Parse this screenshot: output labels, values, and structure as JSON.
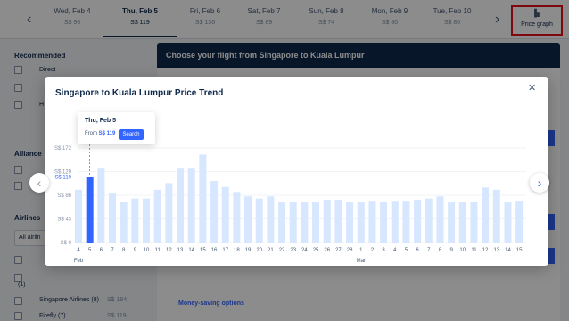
{
  "date_bar": {
    "prev_icon": "chevron-left-icon",
    "next_icon": "chevron-right-icon",
    "dates": [
      {
        "label": "Wed, Feb 4",
        "price": "S$ 96"
      },
      {
        "label": "Thu, Feb 5",
        "price": "S$ 119"
      },
      {
        "label": "Fri, Feb 6",
        "price": "S$ 136"
      },
      {
        "label": "Sat, Feb 7",
        "price": "S$ 89"
      },
      {
        "label": "Sun, Feb 8",
        "price": "S$ 74"
      },
      {
        "label": "Mon, Feb 9",
        "price": "S$ 80"
      },
      {
        "label": "Tue, Feb 10",
        "price": "S$ 80"
      }
    ],
    "active_index": 1,
    "price_graph_label": "Price graph",
    "price_graph_icon": "bar-chart-icon"
  },
  "sidebar": {
    "recommended_heading": "Recommended",
    "recommended_items": [
      "Direct",
      "",
      "H"
    ],
    "alliance_heading": "Alliance",
    "airlines_heading": "Airlines",
    "airlines_select": "All airlin",
    "airline_rows": [
      {
        "name": "",
        "price": ""
      },
      {
        "name": "(1)",
        "price": ""
      },
      {
        "name": "Singapore Airlines (8)",
        "price": "S$ 184"
      },
      {
        "name": "Firefly (7)",
        "price": "S$ 119"
      }
    ]
  },
  "main": {
    "header": "Choose your flight from Singapore to Kuala Lumpur",
    "money_saving": "Money-saving options"
  },
  "modal": {
    "title": "Singapore to Kuala Lumpur Price Trend",
    "close_icon": "close-icon",
    "tooltip": {
      "date": "Thu, Feb 5",
      "from_label": "From",
      "price": "S$ 119",
      "search_label": "Search"
    },
    "prev_icon": "chevron-left-icon",
    "next_icon": "chevron-right-icon"
  },
  "chart_data": {
    "type": "bar",
    "title": "Singapore to Kuala Lumpur Price Trend",
    "categories": [
      "4",
      "5",
      "6",
      "7",
      "8",
      "9",
      "10",
      "11",
      "12",
      "13",
      "14",
      "15",
      "16",
      "17",
      "18",
      "19",
      "20",
      "21",
      "22",
      "23",
      "24",
      "25",
      "26",
      "27",
      "28",
      "1",
      "2",
      "3",
      "4",
      "5",
      "6",
      "7",
      "8",
      "9",
      "10",
      "11",
      "12",
      "13",
      "14",
      "15"
    ],
    "month_labels": [
      {
        "index": 0,
        "label": "Feb"
      },
      {
        "index": 25,
        "label": "Mar"
      }
    ],
    "values": [
      96,
      119,
      136,
      89,
      74,
      80,
      80,
      96,
      108,
      136,
      136,
      160,
      112,
      101,
      92,
      84,
      80,
      84,
      74,
      74,
      74,
      74,
      78,
      78,
      74,
      74,
      76,
      74,
      76,
      76,
      78,
      80,
      84,
      74,
      74,
      74,
      100,
      96,
      74,
      76
    ],
    "selected_index": 1,
    "yticks": [
      {
        "value": 0,
        "label": "S$ 0"
      },
      {
        "value": 43,
        "label": "S$ 43"
      },
      {
        "value": 86,
        "label": "S$ 86"
      },
      {
        "value": 119,
        "label": "S$ 119"
      },
      {
        "value": 129,
        "label": "S$ 129"
      },
      {
        "value": 172,
        "label": "S$ 172"
      }
    ],
    "ylim": [
      0,
      172
    ],
    "reference_value": 119,
    "colors": {
      "bar": "#d6e7ff",
      "selected": "#3264ff",
      "grid": "#e4e8ee",
      "reference": "#3264ff"
    }
  }
}
